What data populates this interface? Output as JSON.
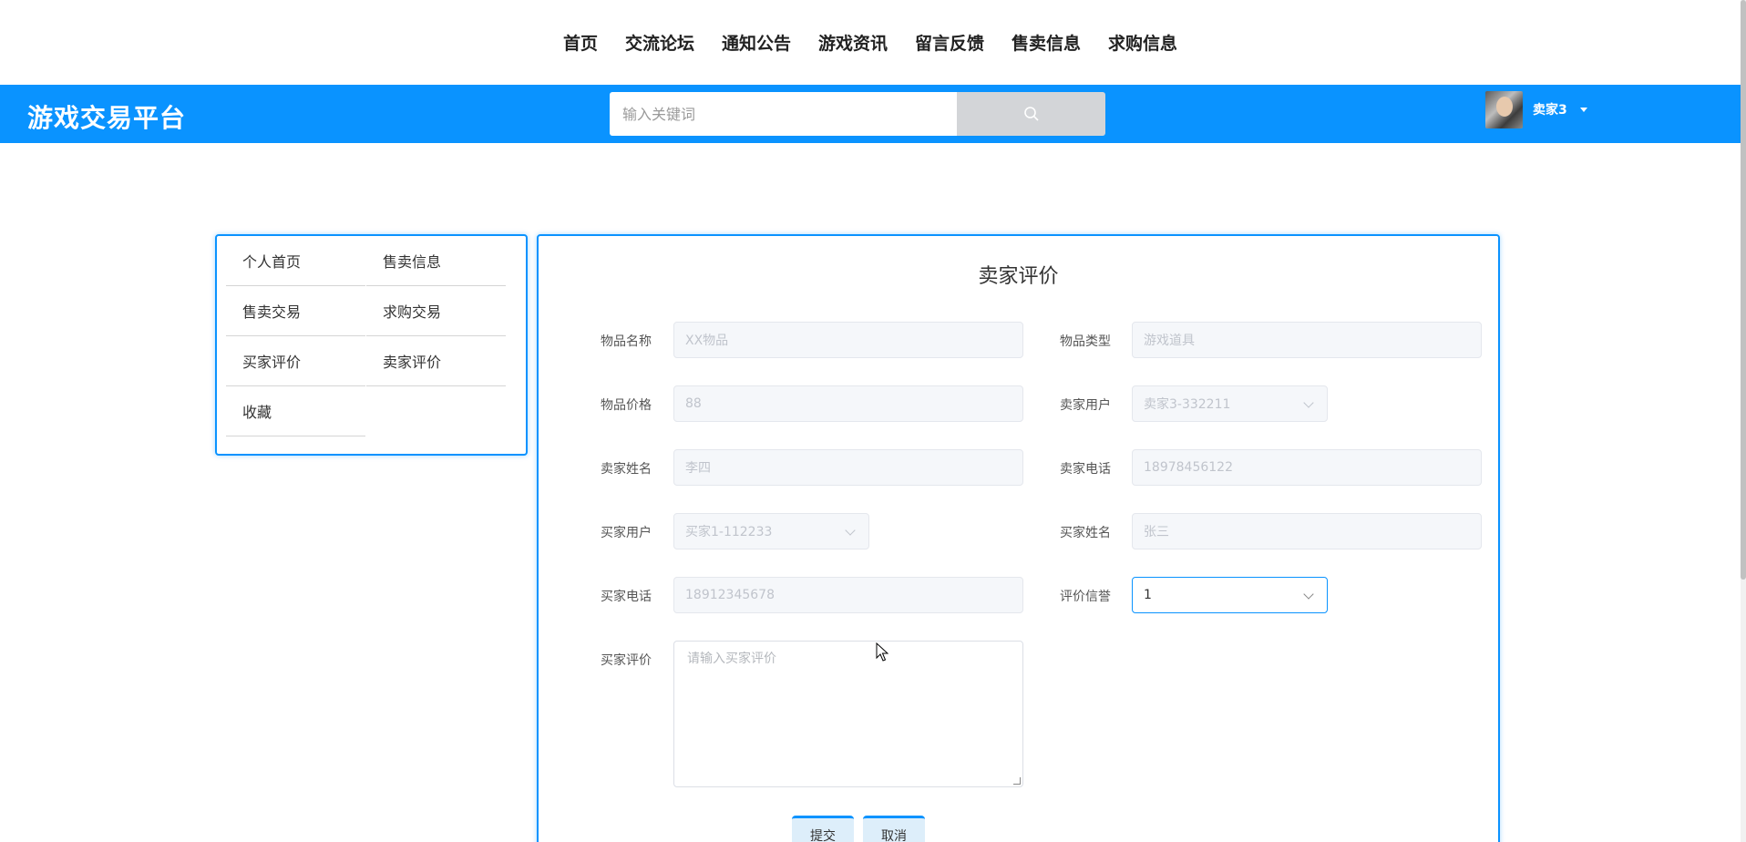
{
  "topnav": {
    "items": [
      "首页",
      "交流论坛",
      "通知公告",
      "游戏资讯",
      "留言反馈",
      "售卖信息",
      "求购信息"
    ]
  },
  "header": {
    "brand": "游戏交易平台",
    "search_placeholder": "输入关键词",
    "username": "卖家3",
    "bar_color": "#0a93ff"
  },
  "sidebar": {
    "items": [
      "个人首页",
      "售卖信息",
      "售卖交易",
      "求购交易",
      "买家评价",
      "卖家评价",
      "收藏"
    ]
  },
  "form": {
    "title": "卖家评价",
    "item_name": {
      "label": "物品名称",
      "value": "XX物品"
    },
    "item_type": {
      "label": "物品类型",
      "value": "游戏道具"
    },
    "item_price": {
      "label": "物品价格",
      "value": "88"
    },
    "seller_user": {
      "label": "卖家用户",
      "value": "卖家3-332211"
    },
    "seller_name": {
      "label": "卖家姓名",
      "value": "李四"
    },
    "seller_phone": {
      "label": "卖家电话",
      "value": "18978456122"
    },
    "buyer_user": {
      "label": "买家用户",
      "value": "买家1-112233"
    },
    "buyer_name": {
      "label": "买家姓名",
      "value": "张三"
    },
    "buyer_phone": {
      "label": "买家电话",
      "value": "18912345678"
    },
    "credit_rating": {
      "label": "评价信誉",
      "value": "1"
    },
    "buyer_review": {
      "label": "买家评价",
      "placeholder": "请输入买家评价"
    },
    "submit_label": "提交",
    "cancel_label": "取消"
  }
}
